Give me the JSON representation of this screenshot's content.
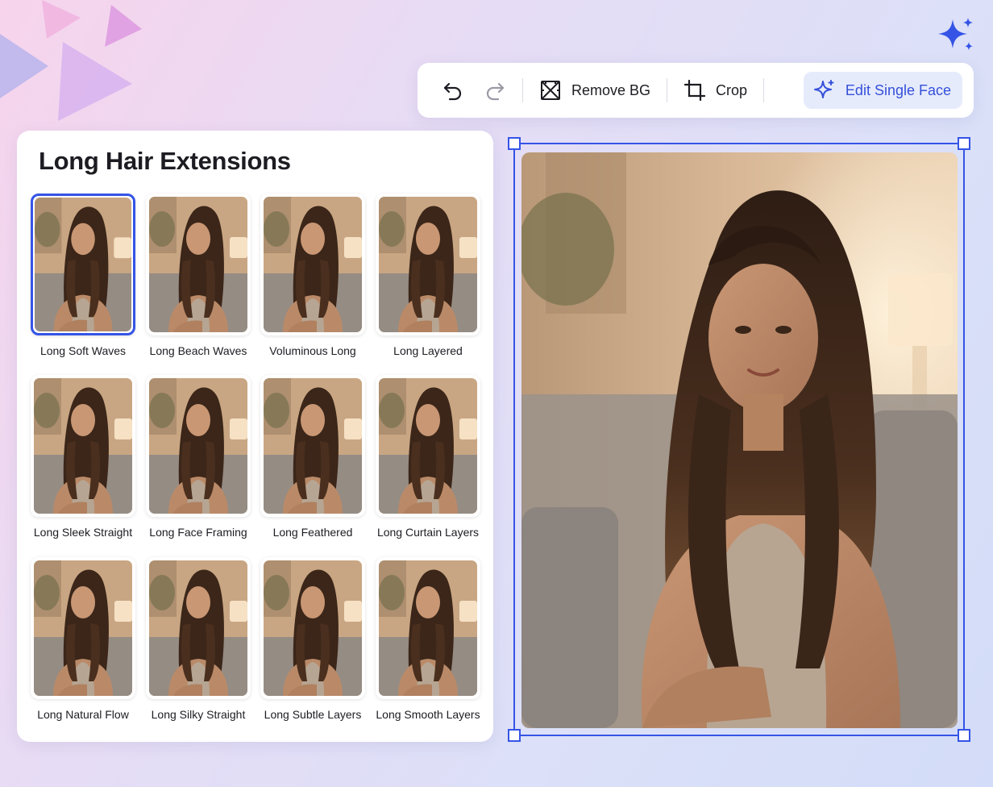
{
  "toolbar": {
    "remove_bg_label": "Remove BG",
    "crop_label": "Crop",
    "edit_face_label": "Edit Single Face"
  },
  "panel": {
    "title": "Long Hair Extensions",
    "styles": [
      {
        "label": "Long Soft Waves",
        "selected": true
      },
      {
        "label": "Long Beach Waves",
        "selected": false
      },
      {
        "label": "Voluminous Long",
        "selected": false
      },
      {
        "label": "Long Layered",
        "selected": false
      },
      {
        "label": "Long Sleek Straight",
        "selected": false
      },
      {
        "label": "Long Face Framing",
        "selected": false
      },
      {
        "label": "Long Feathered",
        "selected": false
      },
      {
        "label": "Long Curtain Layers",
        "selected": false
      },
      {
        "label": "Long Natural Flow",
        "selected": false
      },
      {
        "label": "Long Silky Straight",
        "selected": false
      },
      {
        "label": "Long Subtle Layers",
        "selected": false
      },
      {
        "label": "Long Smooth Layers",
        "selected": false
      }
    ]
  },
  "colors": {
    "accent": "#3554e6",
    "accent_bg": "#e6ebfc"
  },
  "icons": {
    "undo": "undo-icon",
    "redo": "redo-icon",
    "remove_bg": "remove-bg-icon",
    "crop": "crop-icon",
    "edit_face": "sparkle-icon"
  }
}
